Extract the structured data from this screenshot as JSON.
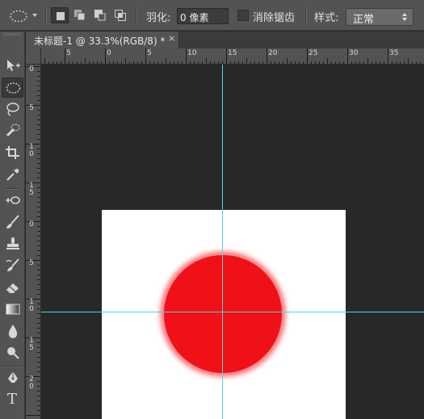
{
  "options_bar": {
    "feather_label": "羽化:",
    "feather_value": "0 像素",
    "antialias_label": "消除锯齿",
    "antialias_checked": false,
    "style_label": "样式:",
    "style_value": "正常",
    "selection_modes": [
      "new-selection",
      "add-to-selection",
      "subtract-from-selection",
      "intersect-with-selection"
    ],
    "active_mode": "new-selection"
  },
  "document": {
    "tab_title": "未标题-1 @ 33.3%(RGB/8) *",
    "close_glyph": "×"
  },
  "ruler_top_labels": [
    "5",
    "0",
    "5",
    "10",
    "15",
    "20",
    "25",
    "30",
    "35"
  ],
  "ruler_left_labels": [
    "0",
    "5",
    "10",
    "15",
    "0",
    "5",
    "10",
    "15",
    "20"
  ],
  "tools": [
    "move-icon",
    "elliptical-marquee-icon",
    "lasso-icon",
    "quick-selection-icon",
    "crop-icon",
    "eyedropper-icon",
    "healing-brush-icon",
    "brush-icon",
    "clone-stamp-icon",
    "history-brush-icon",
    "eraser-icon",
    "gradient-icon",
    "blur-icon",
    "dodge-icon",
    "pen-icon",
    "type-icon"
  ],
  "active_tool": "elliptical-marquee-icon",
  "type_tool_glyph": "T",
  "colors": {
    "canvas": "#ffffff",
    "shape": "#f01018",
    "guide": "#4fd6d6",
    "workspace": "#282828",
    "panel": "#535353"
  }
}
